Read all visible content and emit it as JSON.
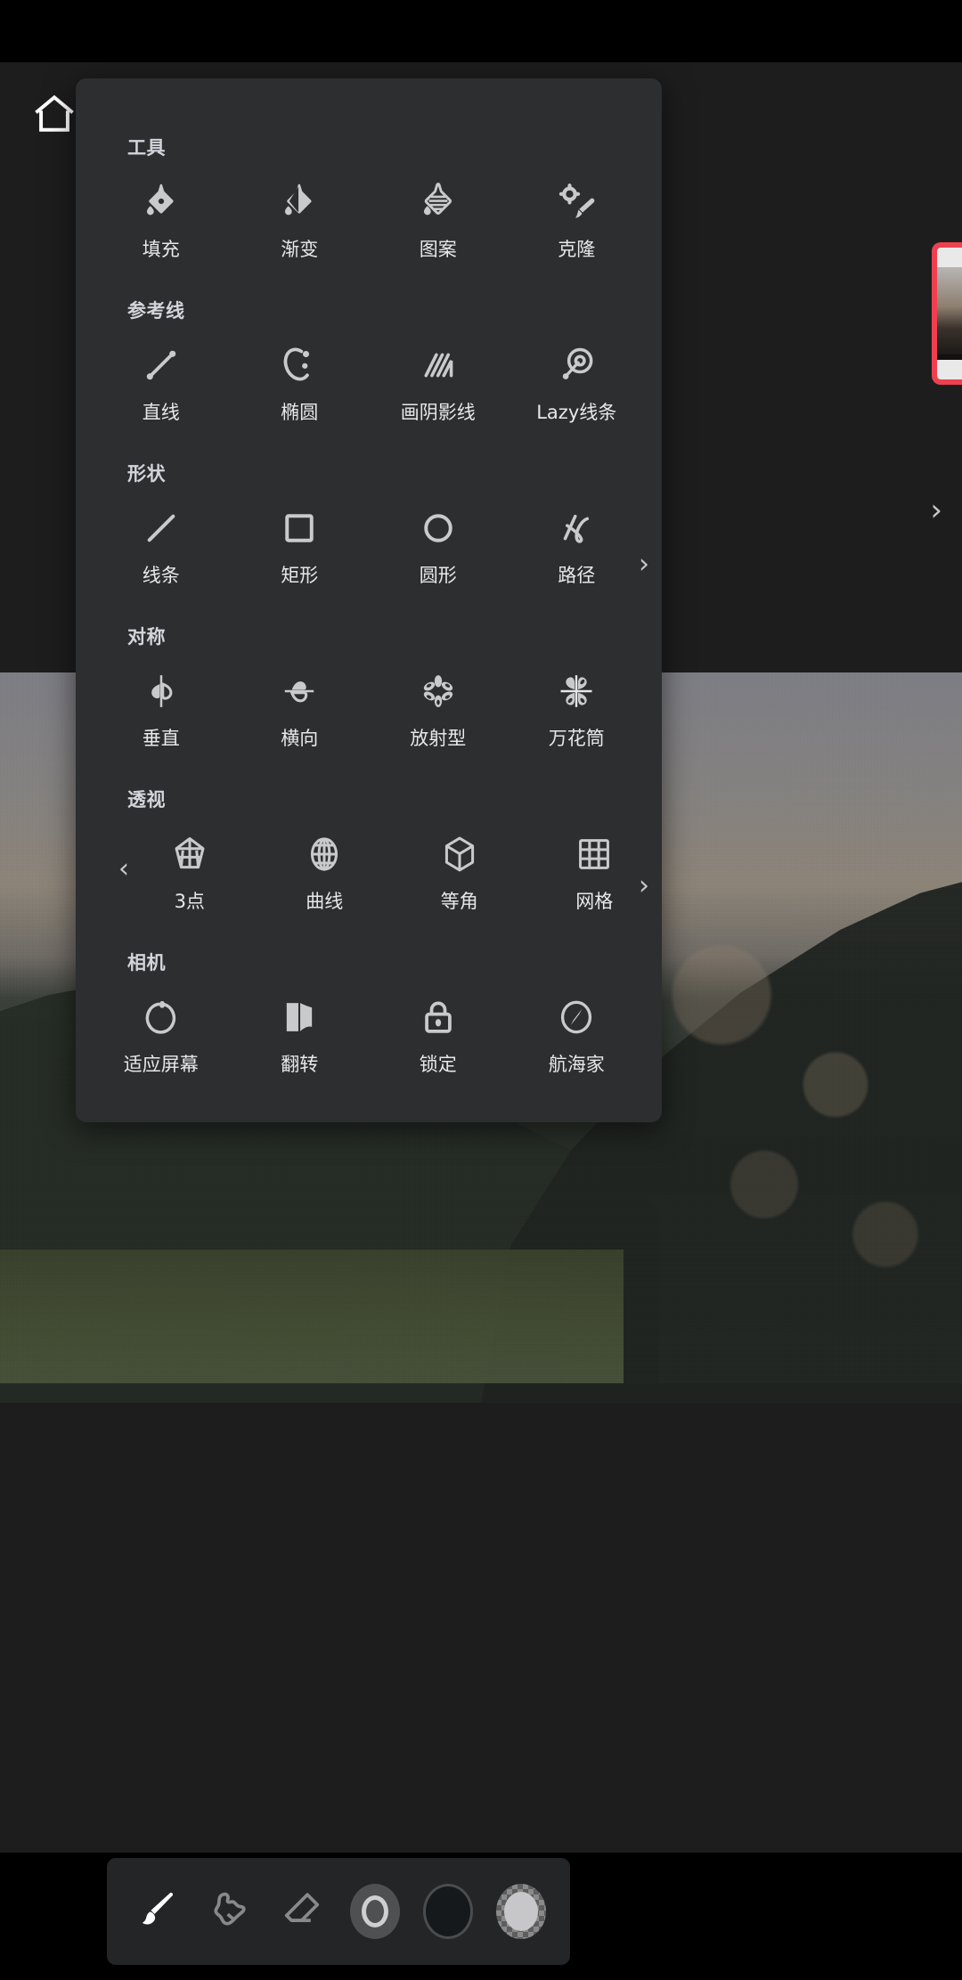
{
  "app": {
    "home_icon": "home-icon",
    "layer_thumbnail_accent": "#ef4050",
    "panel_bg": "#2c2e30",
    "screen_bg": "#1d1d1d"
  },
  "panel": {
    "sections": [
      {
        "title": "工具",
        "has_prev_arrow": false,
        "has_next_arrow": false,
        "items": [
          {
            "label": "填充",
            "icon": "fill-droplet-icon"
          },
          {
            "label": "渐变",
            "icon": "gradient-droplet-icon"
          },
          {
            "label": "图案",
            "icon": "pattern-droplet-icon"
          },
          {
            "label": "克隆",
            "icon": "clone-stamp-icon"
          }
        ]
      },
      {
        "title": "参考线",
        "has_prev_arrow": false,
        "has_next_arrow": true,
        "next_arrow_glyph": "›",
        "items": [
          {
            "label": "直线",
            "icon": "straight-line-guide-icon"
          },
          {
            "label": "椭圆",
            "icon": "ellipse-guide-icon"
          },
          {
            "label": "画阴影线",
            "icon": "hatching-guide-icon"
          },
          {
            "label": "Lazy线条",
            "icon": "lazy-line-guide-icon"
          }
        ]
      },
      {
        "title": "形状",
        "has_prev_arrow": false,
        "has_next_arrow": true,
        "next_arrow_glyph": "›",
        "items": [
          {
            "label": "线条",
            "icon": "line-shape-icon"
          },
          {
            "label": "矩形",
            "icon": "rectangle-shape-icon"
          },
          {
            "label": "圆形",
            "icon": "circle-shape-icon"
          },
          {
            "label": "路径",
            "icon": "path-shape-icon"
          }
        ]
      },
      {
        "title": "对称",
        "has_prev_arrow": false,
        "has_next_arrow": false,
        "items": [
          {
            "label": "垂直",
            "icon": "vertical-symmetry-icon"
          },
          {
            "label": "横向",
            "icon": "horizontal-symmetry-icon"
          },
          {
            "label": "放射型",
            "icon": "radial-symmetry-icon"
          },
          {
            "label": "万花筒",
            "icon": "kaleidoscope-symmetry-icon"
          }
        ]
      },
      {
        "title": "透视",
        "has_prev_arrow": true,
        "prev_arrow_glyph": "‹",
        "has_next_arrow": false,
        "items": [
          {
            "label": "3点",
            "icon": "three-point-perspective-icon"
          },
          {
            "label": "曲线",
            "icon": "curvilinear-perspective-icon"
          },
          {
            "label": "等角",
            "icon": "isometric-perspective-icon"
          },
          {
            "label": "网格",
            "icon": "grid-perspective-icon"
          }
        ]
      },
      {
        "title": "相机",
        "has_prev_arrow": false,
        "has_next_arrow": false,
        "items": [
          {
            "label": "适应屏幕",
            "icon": "fit-to-screen-icon"
          },
          {
            "label": "翻转",
            "icon": "flip-canvas-icon"
          },
          {
            "label": "锁定",
            "icon": "lock-canvas-icon"
          },
          {
            "label": "航海家",
            "icon": "navigator-compass-icon"
          }
        ]
      }
    ]
  },
  "toolbar": {
    "items": [
      {
        "name": "brush-tool",
        "icon": "paintbrush-icon",
        "active": true
      },
      {
        "name": "smudge-tool",
        "icon": "smudge-icon",
        "active": false
      },
      {
        "name": "eraser-tool",
        "icon": "eraser-icon",
        "active": false
      },
      {
        "name": "brush-size",
        "icon": "brush-size-swatch",
        "active": false
      },
      {
        "name": "color-swatch",
        "icon": "color-swatch",
        "active": false
      },
      {
        "name": "opacity-swatch",
        "icon": "transparency-swatch",
        "active": false
      }
    ]
  },
  "canvas": {
    "side_next_arrow_glyph": "›"
  }
}
